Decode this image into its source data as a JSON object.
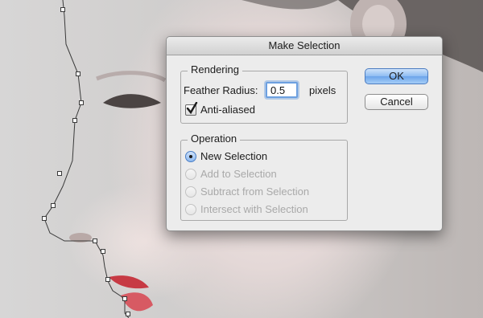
{
  "dialog": {
    "title": "Make Selection",
    "rendering": {
      "label": "Rendering",
      "feather_label": "Feather Radius:",
      "feather_value": "0.5",
      "feather_units": "pixels",
      "anti_aliased_label": "Anti-aliased",
      "anti_aliased_checked": true
    },
    "operation": {
      "label": "Operation",
      "options": [
        {
          "label": "New Selection",
          "selected": true,
          "enabled": true
        },
        {
          "label": "Add to Selection",
          "selected": false,
          "enabled": false
        },
        {
          "label": "Subtract from Selection",
          "selected": false,
          "enabled": false
        },
        {
          "label": "Intersect with Selection",
          "selected": false,
          "enabled": false
        }
      ]
    },
    "buttons": {
      "ok_label": "OK",
      "cancel_label": "Cancel"
    }
  },
  "colors": {
    "accent": "#6ca4ea",
    "path_anchor": "#ffffff",
    "path_stroke": "#3a3a3a"
  }
}
